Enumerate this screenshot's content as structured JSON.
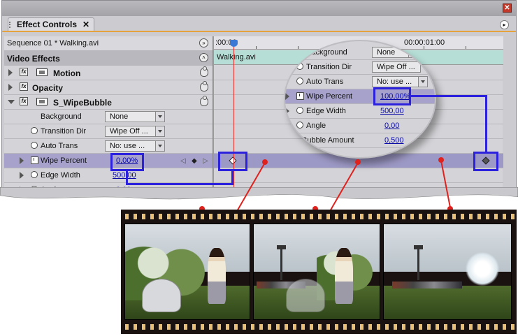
{
  "panel": {
    "tab_title": "Effect Controls",
    "tab_close": "✕",
    "sequence_label": "Sequence 01 * Walking.avi",
    "video_effects_label": "Video Effects"
  },
  "effects": {
    "motion": "Motion",
    "opacity": "Opacity",
    "wipebubble": "S_WipeBubble"
  },
  "params": {
    "background": {
      "label": "Background",
      "value": "None"
    },
    "transition_dir": {
      "label": "Transition Dir",
      "value": "Wipe Off ..."
    },
    "auto_trans": {
      "label": "Auto Trans",
      "value": "No: use ..."
    },
    "wipe_percent": {
      "label": "Wipe Percent",
      "value_left": "0,00%",
      "value_zoom": "100,00%"
    },
    "edge_width": {
      "label": "Edge Width",
      "value": "500,00"
    },
    "angle": {
      "label": "Angle",
      "value": "0,00"
    },
    "bubble_amount": {
      "label": "Bubble Amount",
      "value": "0,500"
    }
  },
  "timeline": {
    "start_time": ":00:00",
    "end_time": "00:00:01:00",
    "clip_name": "Walking.avi"
  },
  "icons": [
    "close-icon",
    "panel-menu-icon",
    "scroll-end-icon",
    "collapse-up-icon",
    "fx-icon",
    "film-icon",
    "reset-icon",
    "stopwatch-icon",
    "keyframe-icon",
    "playhead-icon"
  ],
  "colors": {
    "highlight_box": "#2c22dd",
    "leader_line": "#e0221e",
    "selected_row": "#a6a2cc",
    "clip_bar": "#b6ded6",
    "tab_accent": "#e6a23c"
  }
}
